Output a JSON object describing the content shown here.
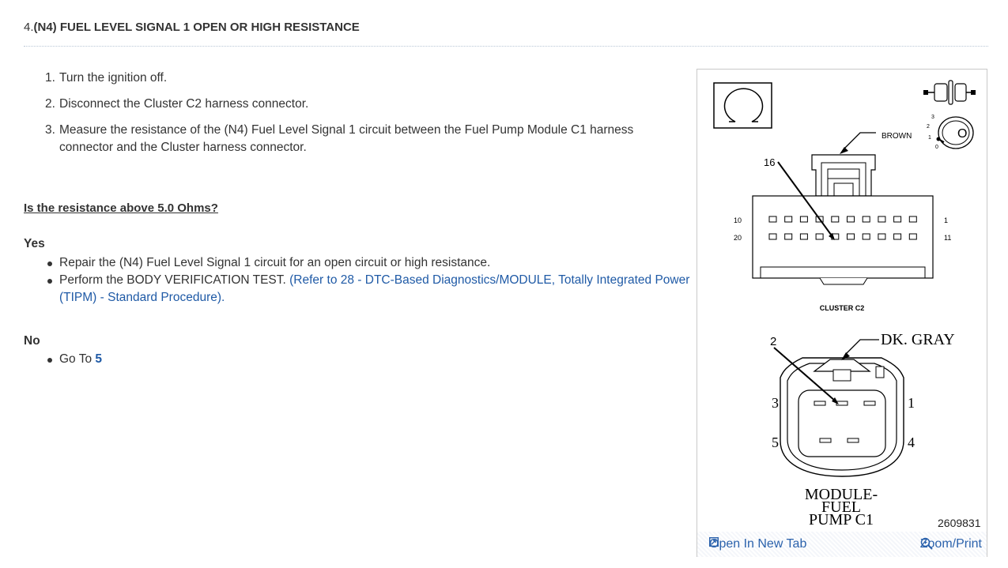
{
  "heading": {
    "number": "4.",
    "title": "(N4) FUEL LEVEL SIGNAL 1 OPEN OR HIGH RESISTANCE"
  },
  "steps": [
    {
      "num": "1.",
      "text": "Turn the ignition off."
    },
    {
      "num": "2.",
      "text": "Disconnect the Cluster C2 harness connector."
    },
    {
      "num": "3.",
      "text": "Measure the resistance of the (N4) Fuel Level Signal 1 circuit between the Fuel Pump Module C1 harness connector and the Cluster harness connector."
    }
  ],
  "question": "Is the resistance above 5.0 Ohms?",
  "yes": {
    "label": "Yes",
    "item1": "Repair the (N4) Fuel Level Signal 1 circuit for an open circuit or high resistance.",
    "item2_text": "Perform the BODY VERIFICATION TEST.",
    "item2_link": "(Refer to 28 - DTC-Based Diagnostics/MODULE, Totally Integrated Power (TIPM) - Standard Procedure)."
  },
  "no": {
    "label": "No",
    "goto_text": "Go To",
    "goto_link": "5"
  },
  "figure": {
    "brown": "BROWN",
    "pin16": "16",
    "row1_left": "10",
    "row1_right": "1",
    "row2_left": "20",
    "row2_right": "11",
    "cluster_label": "CLUSTER C2",
    "dk_gray": "DK. GRAY",
    "pin2": "2",
    "pin3": "3",
    "pin1": "1",
    "pin5": "5",
    "pin4": "4",
    "module_line1": "MODULE-",
    "module_line2": "FUEL",
    "module_line3": "PUMP C1",
    "key_positions": [
      "3",
      "2",
      "1",
      "0"
    ],
    "key_letter": "O",
    "figure_id": "2609831",
    "open_new_tab": "Open In New Tab",
    "zoom_print": "Zoom/Print"
  },
  "colors": {
    "link": "#1f5aa6",
    "text": "#333333"
  }
}
